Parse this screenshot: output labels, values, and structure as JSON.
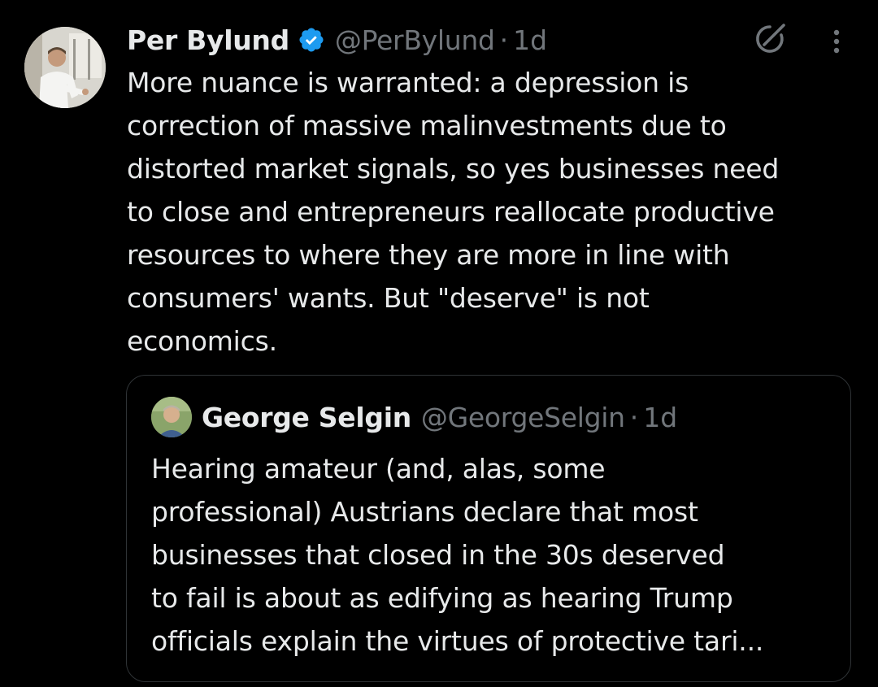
{
  "tweet": {
    "author_name": "Per Bylund",
    "handle": "@PerBylund",
    "separator": "·",
    "time": "1d",
    "text": "More nuance is warranted: a depression is\ncorrection of massive malinvestments due to\ndistorted market signals, so yes businesses need\nto close and entrepreneurs reallocate productive\nresources to where they are more in line with\nconsumers' wants. But \"deserve\" is not\neconomics."
  },
  "quote": {
    "author_name": "George Selgin",
    "handle": "@GeorgeSelgin",
    "separator": "·",
    "time": "1d",
    "text": "Hearing amateur (and, alas, some\nprofessional) Austrians declare that most\nbusinesses that closed in the 30s deserved\nto fail is about as edifying as hearing Trump\nofficials explain the virtues of protective tari..."
  },
  "icons": {
    "verified": "verified-badge-icon",
    "grok": "grok-icon",
    "more": "more-options-icon"
  },
  "colors": {
    "background": "#000000",
    "text": "#e7e9ea",
    "secondary": "#71767b",
    "verified": "#1d9bf0",
    "border": "#2f3336"
  }
}
